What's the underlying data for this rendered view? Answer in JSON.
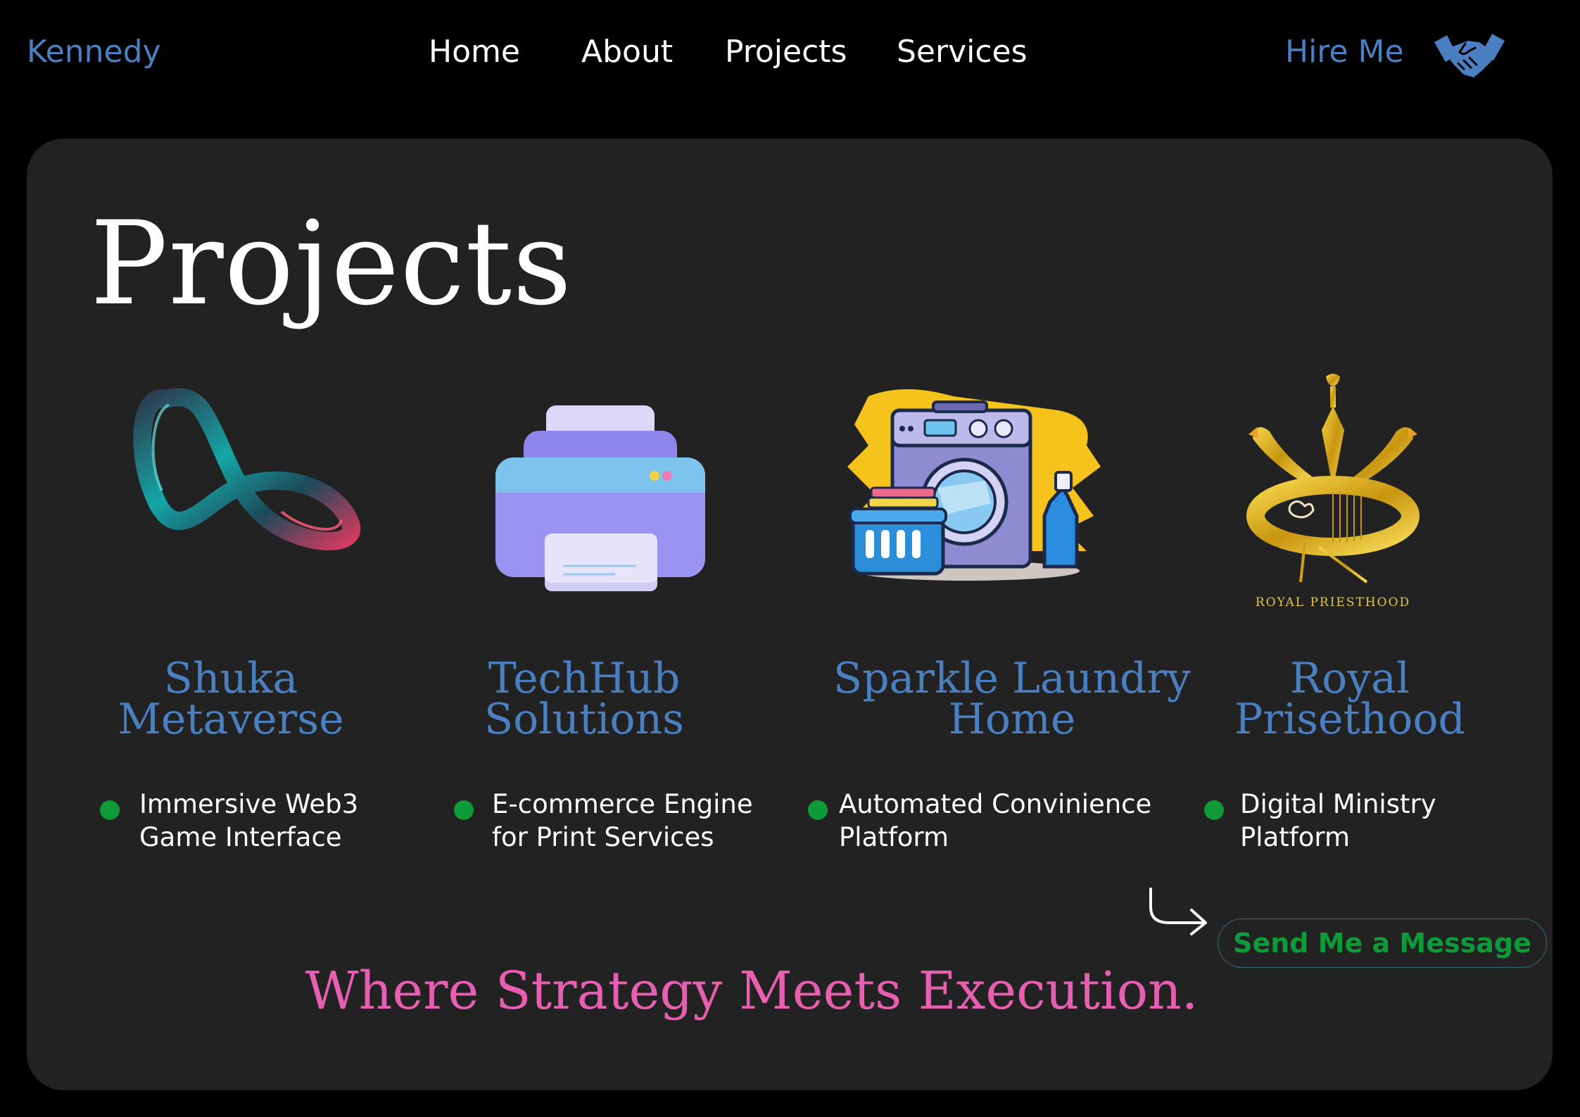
{
  "header": {
    "brand": "Kennedy",
    "nav": [
      "Home",
      "About",
      "Projects",
      "Services"
    ],
    "cta_label": "Hire Me",
    "cta_icon": "handshake-icon"
  },
  "main": {
    "title": "Projects",
    "projects": [
      {
        "name_lines": [
          "Shuka",
          "Metaverse"
        ],
        "desc_lines": [
          "Immersive Web3",
          "Game Interface"
        ],
        "image": "infinity-loop-3d-icon"
      },
      {
        "name_lines": [
          "TechHub",
          "Solutions"
        ],
        "desc_lines": [
          "E-commerce Engine",
          "for Print Services"
        ],
        "image": "printer-icon"
      },
      {
        "name_lines": [
          "Sparkle Laundry",
          "Home"
        ],
        "desc_lines": [
          "Automated Convinience",
          "Platform"
        ],
        "image": "washing-machine-illustration"
      },
      {
        "name_lines": [
          "Royal",
          "Prisethood"
        ],
        "desc_lines": [
          "Digital Ministry",
          "Platform"
        ],
        "image": "royal-priesthood-crown-logo",
        "logo_text": "ROYAL PRIESTHOOD"
      }
    ],
    "send_message_label": "Send Me a Message",
    "tagline": "Where Strategy Meets Execution."
  },
  "colors": {
    "background": "#000000",
    "panel": "#222222",
    "accent_blue": "#4a7fc1",
    "accent_green": "#0e9a38",
    "accent_pink": "#e85fb2"
  }
}
